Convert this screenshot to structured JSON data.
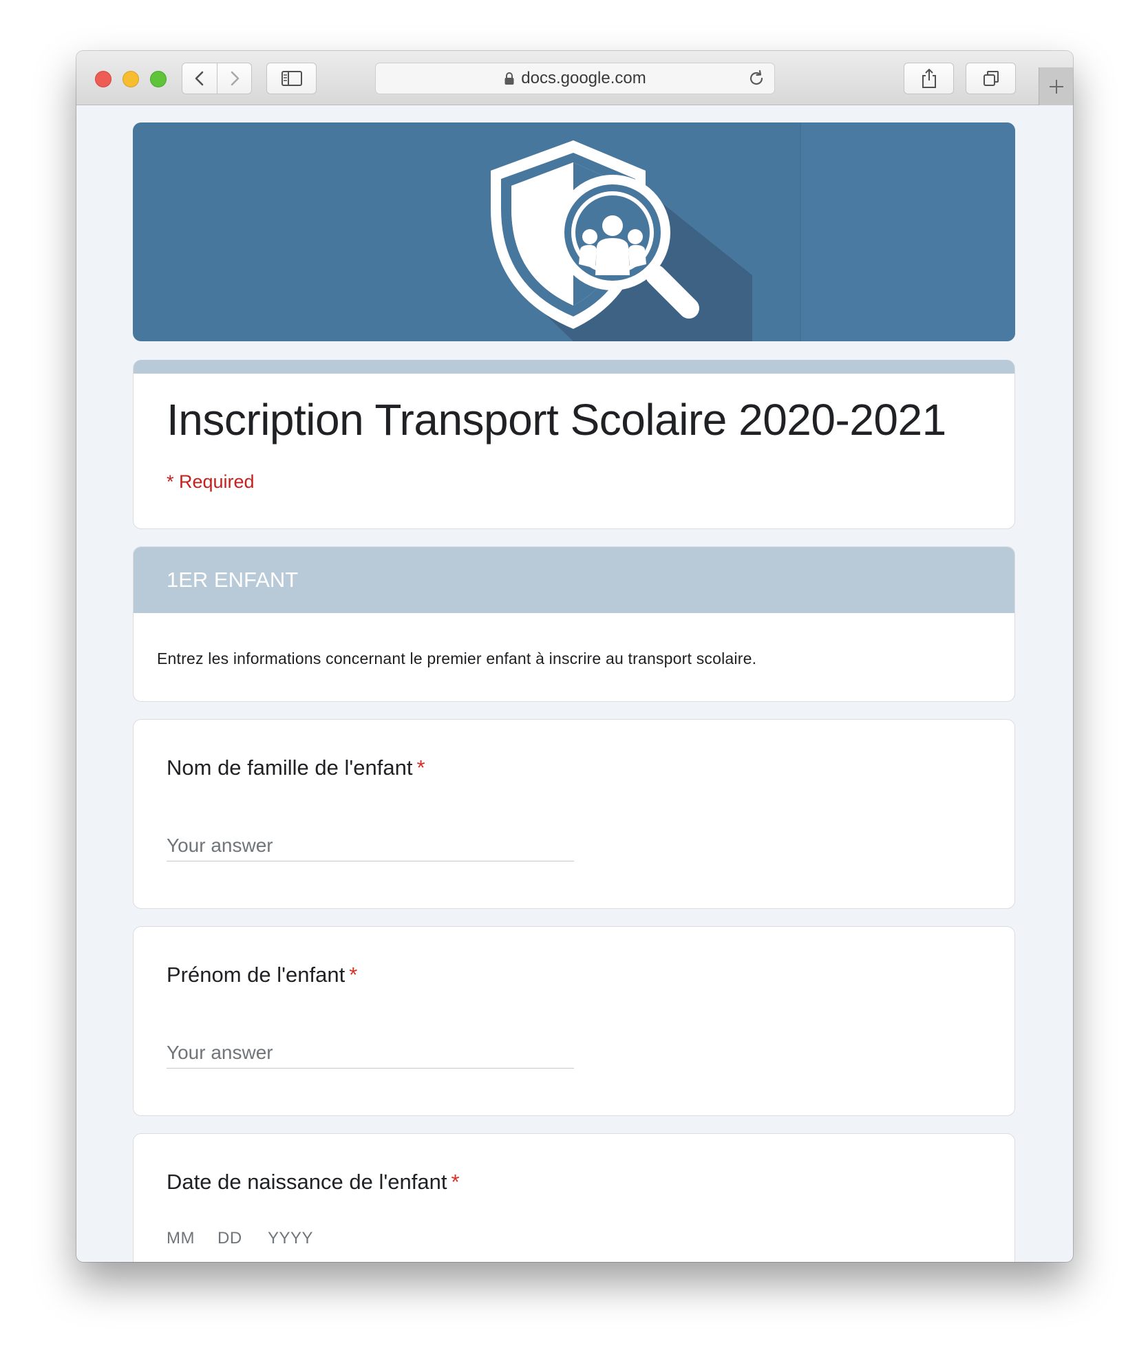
{
  "browser": {
    "url": "docs.google.com"
  },
  "form": {
    "title": "Inscription Transport Scolaire 2020-2021",
    "required_note": "* Required",
    "accent_color": "#48779e",
    "header_tint": "#b8cad8"
  },
  "section": {
    "heading": "1ER ENFANT",
    "description": "Entrez les informations concernant le premier enfant à inscrire au transport scolaire."
  },
  "questions": [
    {
      "label": "Nom de famille de l'enfant",
      "required_mark": "*",
      "placeholder": "Your answer"
    },
    {
      "label": "Prénom de l'enfant",
      "required_mark": "*",
      "placeholder": "Your answer"
    },
    {
      "label": "Date de naissance de l'enfant",
      "required_mark": "*",
      "date_parts": [
        "MM",
        "DD",
        "YYYY"
      ]
    }
  ]
}
